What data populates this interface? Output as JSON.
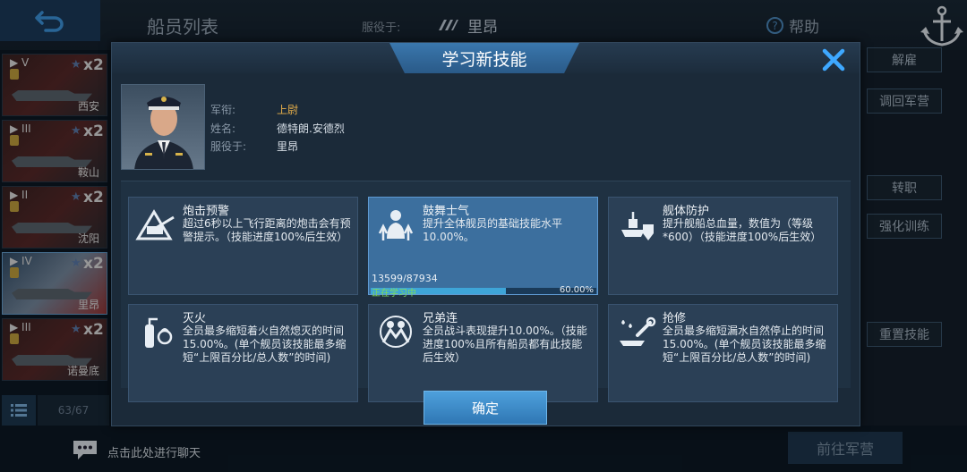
{
  "header": {
    "title": "船员列表",
    "served_label": "服役于:",
    "served_value": "里昂",
    "help_label": "帮助"
  },
  "ship_list": [
    {
      "tier": "▶ V",
      "mult": "x2",
      "name": "西安"
    },
    {
      "tier": "▶ III",
      "mult": "x2",
      "name": "鞍山"
    },
    {
      "tier": "▶ II",
      "mult": "x2",
      "name": "沈阳"
    },
    {
      "tier": "▶ IV",
      "mult": "x2",
      "name": "里昂"
    },
    {
      "tier": "▶ III",
      "mult": "x2",
      "name": "诺曼底"
    }
  ],
  "ship_count": "63/67",
  "side_buttons": [
    "解雇",
    "调回军营",
    "转职",
    "强化训练",
    "重置技能"
  ],
  "goto_button": "前往军营",
  "chat": {
    "text": "点击此处进行聊天"
  },
  "modal": {
    "title": "学习新技能",
    "officer": {
      "rank_label": "军衔:",
      "rank_value": "上尉",
      "name_label": "姓名:",
      "name_value": "德特朗.安德烈",
      "served_label": "服役于:",
      "served_value": "里昂"
    },
    "skills": [
      {
        "icon": "artillery-icon",
        "title": "炮击预警",
        "desc": "超过6秒以上飞行距离的炮击会有预警提示。（技能进度100%后生效）"
      },
      {
        "icon": "morale-icon",
        "title": "鼓舞士气",
        "desc": "提升全体舰员的基础技能水平10.00%。",
        "progress_text": "13599/87934",
        "progress_status": "正在学习中",
        "progress_pct": "60.00%",
        "progress_value": 0.6
      },
      {
        "icon": "hull-protection-icon",
        "title": "舰体防护",
        "desc": "提升舰船总血量，数值为（等级*600）（技能进度100%后生效）"
      },
      {
        "icon": "fire-extinguisher-icon",
        "title": "灭火",
        "desc": "全员最多缩短着火自然熄灭的时间15.00%。(单个舰员该技能最多缩短“上限百分比/总人数”的时间)"
      },
      {
        "icon": "brotherhood-icon",
        "title": "兄弟连",
        "desc": "全员战斗表现提升10.00%。（技能进度100%且所有船员都有此技能后生效）"
      },
      {
        "icon": "repair-icon",
        "title": "抢修",
        "desc": "全员最多缩短漏水自然停止的时间15.00%。(单个舰员该技能最多缩短“上限百分比/总人数”的时间)"
      }
    ],
    "confirm_label": "确定"
  }
}
